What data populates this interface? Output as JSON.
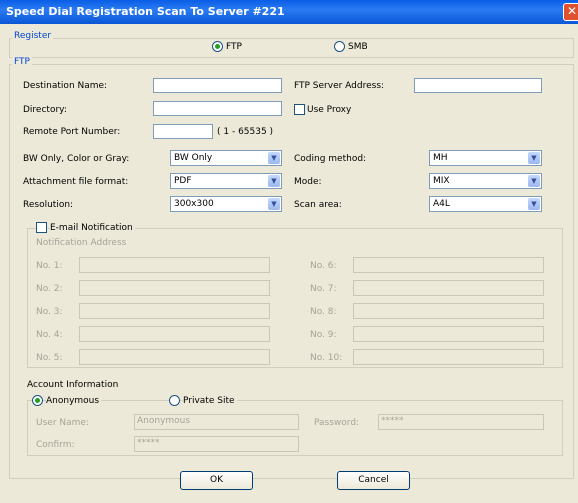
{
  "window": {
    "title": "Speed Dial Registration Scan To Server #221",
    "close_glyph": "✕"
  },
  "register": {
    "legend": "Register",
    "options": [
      {
        "label": "FTP",
        "selected": true
      },
      {
        "label": "SMB",
        "selected": false
      }
    ]
  },
  "ftp": {
    "legend": "FTP",
    "destination_name_label": "Destination Name:",
    "destination_name_value": "",
    "ftp_server_label": "FTP Server Address:",
    "ftp_server_value": "",
    "directory_label": "Directory:",
    "directory_value": "",
    "use_proxy_label": "Use Proxy",
    "use_proxy_checked": false,
    "remote_port_label": "Remote Port Number:",
    "remote_port_value": "",
    "remote_port_range": "( 1 - 65535 )",
    "color_label": "BW Only, Color or Gray:",
    "color_value": "BW Only",
    "coding_label": "Coding method:",
    "coding_value": "MH",
    "format_label": "Attachment file format:",
    "format_value": "PDF",
    "mode_label": "Mode:",
    "mode_value": "MIX",
    "resolution_label": "Resolution:",
    "resolution_value": "300x300",
    "scan_area_label": "Scan area:",
    "scan_area_value": "A4L"
  },
  "email": {
    "label": "E-mail Notification",
    "checked": false,
    "address_label": "Notification Address",
    "left": [
      "No. 1:",
      "No. 2:",
      "No. 3:",
      "No. 4:",
      "No. 5:"
    ],
    "right": [
      "No. 6:",
      "No. 7:",
      "No. 8:",
      "No. 9:",
      "No. 10:"
    ]
  },
  "account": {
    "heading": "Account Information",
    "anonymous_label": "Anonymous",
    "anonymous_selected": true,
    "private_label": "Private Site",
    "private_selected": false,
    "username_label": "User Name:",
    "username_value": "Anonymous",
    "password_label": "Password:",
    "password_value": "*****",
    "confirm_label": "Confirm:",
    "confirm_value": "*****"
  },
  "buttons": {
    "ok": "OK",
    "cancel": "Cancel"
  },
  "icons": {
    "select_arrow": "chevron-down-icon"
  },
  "colors": {
    "title_bar": "#0a5ee6",
    "legend_text": "#0046d5",
    "face": "#ece9d8"
  }
}
